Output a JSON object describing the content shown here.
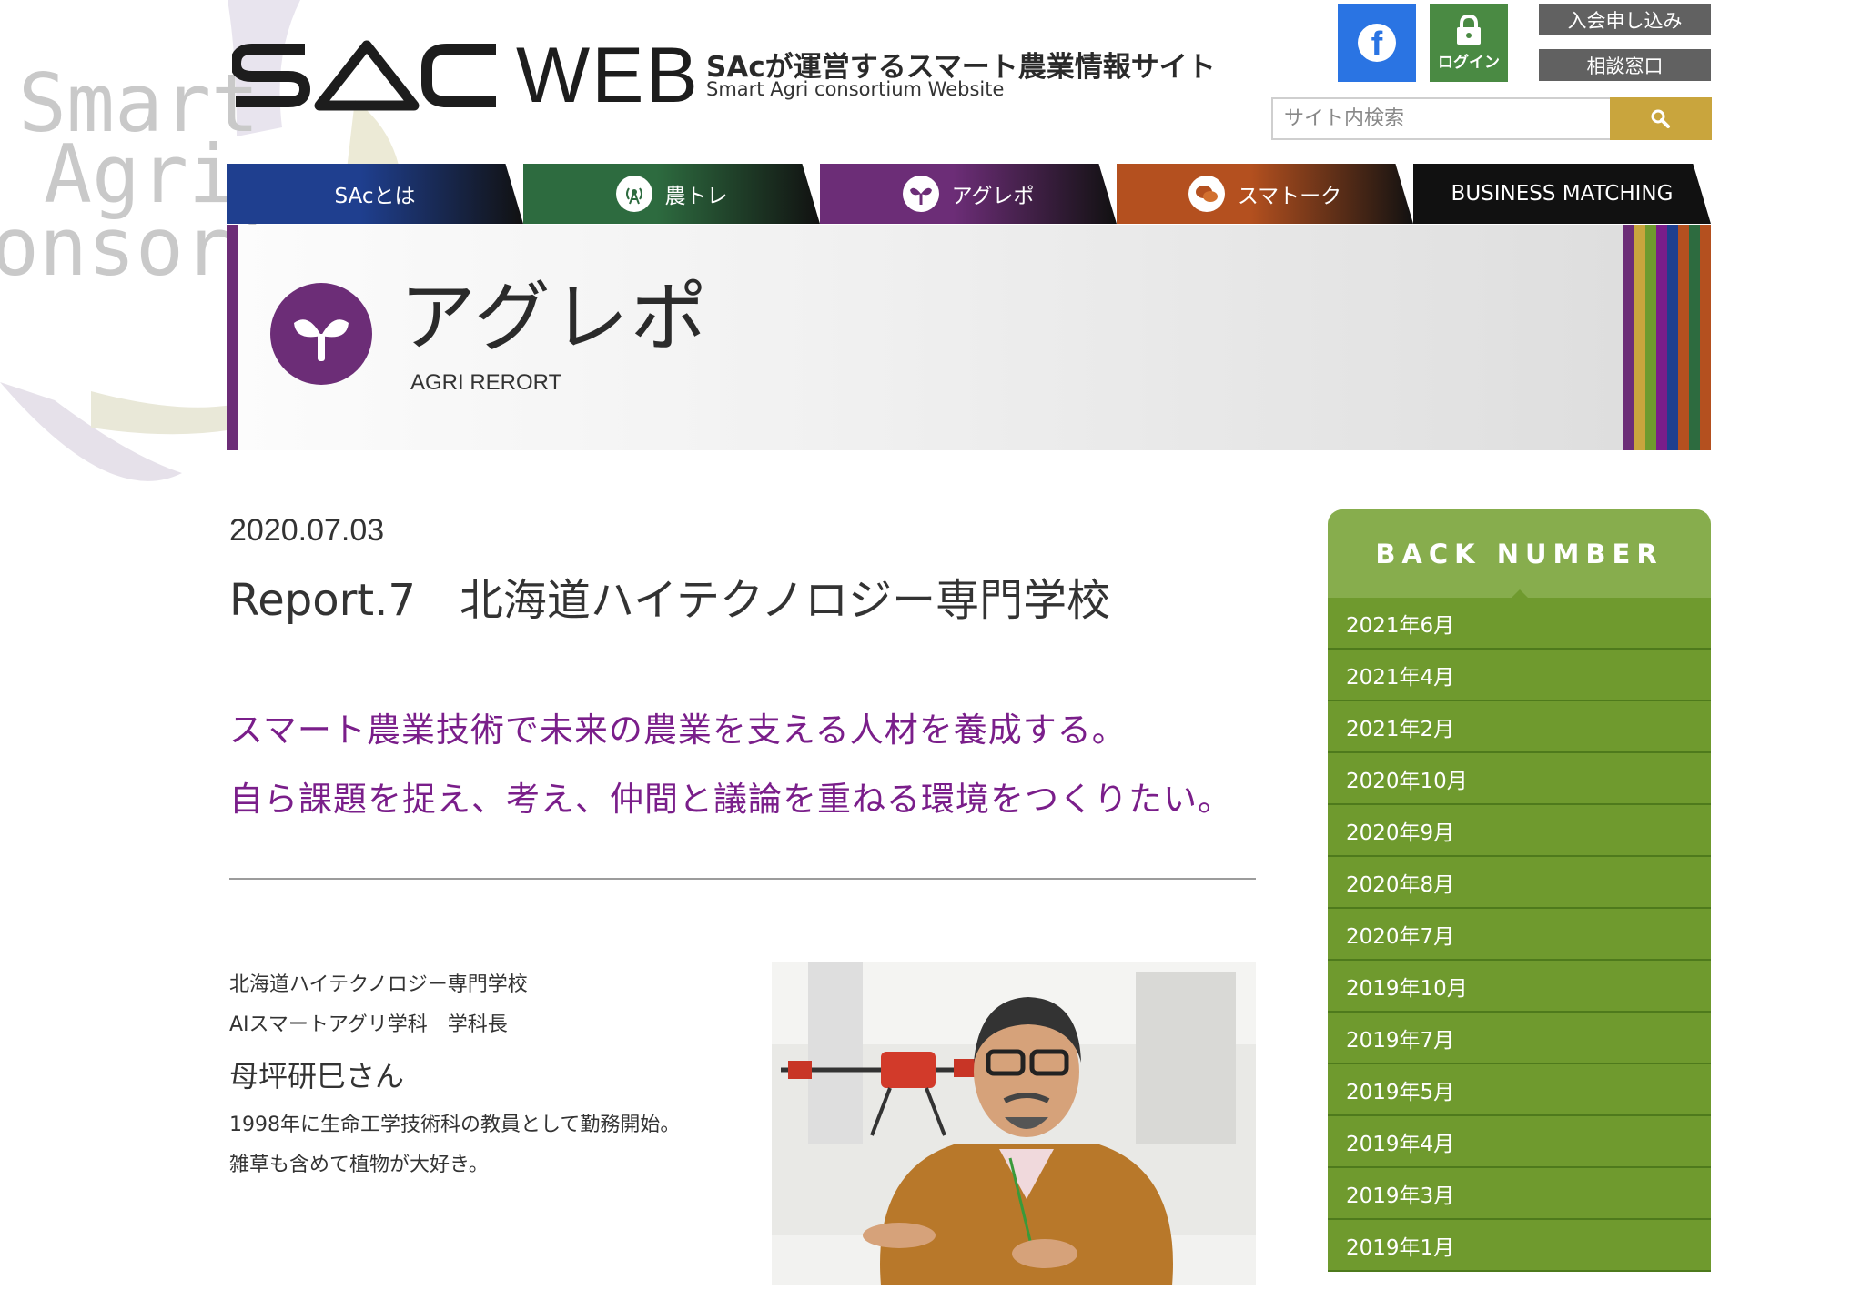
{
  "watermark": {
    "line1": "Smart",
    "line2": "Agri",
    "line3": "onsortium"
  },
  "header": {
    "logo_text": "SAC",
    "logo_web": "WEB",
    "tagline": "SAcが運営するスマート農業情報サイト",
    "tagline_sub": "Smart Agri consortium Website",
    "login_label": "ログイン",
    "join_label": "入会申し込み",
    "consult_label": "相談窓口",
    "search_placeholder": "サイト内検索"
  },
  "nav": {
    "items": [
      {
        "label": "SAcとは",
        "color": "#1f3f8f"
      },
      {
        "label": "農トレ",
        "color": "#2d6b3f"
      },
      {
        "label": "アグレポ",
        "color": "#6c2d77"
      },
      {
        "label": "スマトーク",
        "color": "#b4501f"
      },
      {
        "label": "BUSINESS MATCHING",
        "color": "#111111"
      }
    ]
  },
  "banner": {
    "title": "アグレポ",
    "subtitle": "AGRI RERORT",
    "accent": "#6c2d77",
    "stripes": [
      "#6c2d77",
      "#c9a53d",
      "#6f9a2e",
      "#7a1e8a",
      "#1f3f8f",
      "#b4501f",
      "#2d6b3f",
      "#b4501f"
    ]
  },
  "article": {
    "date": "2020.07.03",
    "title": "Report.7　北海道ハイテクノロジー専門学校",
    "lead1": "スマート農業技術で未来の農業を支える人材を養成する。",
    "lead2": "自ら課題を捉え、考え、仲間と議論を重ねる環境をつくりたい。",
    "profile": {
      "org": "北海道ハイテクノロジー専門学校",
      "role": "AIスマートアグリ学科　学科長",
      "name": "母坪研巳さん",
      "bio1": "1998年に生命工学技術科の教員として勤務開始。",
      "bio2": "雑草も含めて植物が大好き。"
    }
  },
  "sidebar": {
    "heading": "BACK NUMBER",
    "items": [
      "2021年6月",
      "2021年4月",
      "2021年2月",
      "2020年10月",
      "2020年9月",
      "2020年8月",
      "2020年7月",
      "2019年10月",
      "2019年7月",
      "2019年5月",
      "2019年4月",
      "2019年3月",
      "2019年1月"
    ]
  }
}
